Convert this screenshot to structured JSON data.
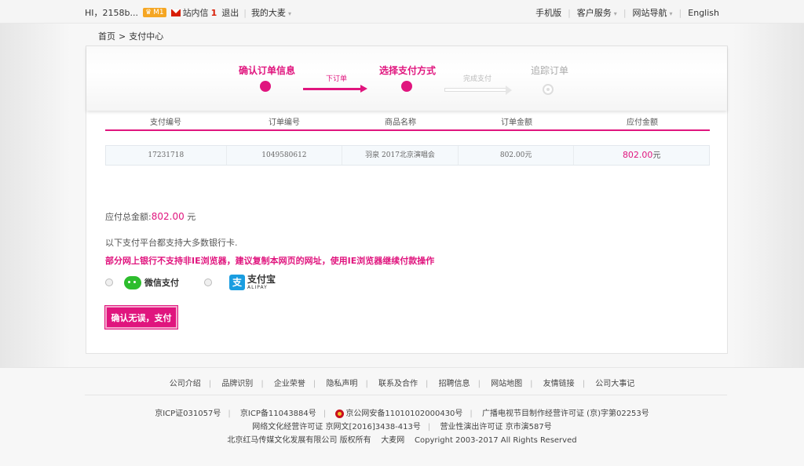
{
  "topbar": {
    "greeting": "HI，2158b...",
    "level_badge": "M1",
    "messages_label": "站内信",
    "messages_count": "1",
    "logout": "退出",
    "my_damai": "我的大麦",
    "right": [
      "手机版",
      "客户服务",
      "网站导航",
      "English"
    ]
  },
  "breadcrumb": {
    "home": "首页",
    "separator": ">",
    "current": "支付中心"
  },
  "steps": {
    "step1": "确认订单信息",
    "arrow1": "下订单",
    "step2": "选择支付方式",
    "arrow2": "完成支付",
    "step3": "追踪订单"
  },
  "table": {
    "headers": [
      "支付编号",
      "订单编号",
      "商品名称",
      "订单金额",
      "应付金额"
    ],
    "row": {
      "pay_id": "17231718",
      "order_id": "1049580612",
      "product": "羽泉 2017北京演唱会",
      "order_amount": "802.00元",
      "due_amount": "802.00",
      "due_unit": "元"
    }
  },
  "summary": {
    "total_label": "应付总金额:",
    "total_value": "802.00",
    "total_unit": "元",
    "bank_note": "以下支付平台都支持大多数银行卡.",
    "ie_warning": "部分网上银行不支持非IE浏览器，建议复制本网页的网址，使用IE浏览器继续付款操作"
  },
  "payment_options": {
    "wechat": "微信支付",
    "alipay_cn": "支付宝",
    "alipay_en": "ALIPAY"
  },
  "pay_button": "确认无误，支付",
  "footer": {
    "links": [
      "公司介绍",
      "品牌识别",
      "企业荣誉",
      "隐私声明",
      "联系及合作",
      "招聘信息",
      "网站地图",
      "友情链接",
      "公司大事记"
    ],
    "row1": [
      "京ICP证031057号",
      "京ICP备11043884号",
      "京公网安备11010102000430号",
      "广播电视节目制作经营许可证 (京)字第02253号"
    ],
    "row2": [
      "网络文化经营许可证 京网文[2016]3438-413号",
      "营业性演出许可证 京市演587号"
    ],
    "row3": "北京红马传媒文化发展有限公司 版权所有    大麦网    Copyright 2003-2017 All Rights Reserved"
  },
  "colors": {
    "accent": "#e0157e",
    "wechat": "#2dbd2d",
    "alipay": "#1a9de0"
  },
  "icons": [
    "crown-icon",
    "mail-icon",
    "chevron-down-icon",
    "wechat-icon",
    "alipay-icon",
    "police-badge-icon",
    "radio-icon",
    "arrow-icon"
  ]
}
